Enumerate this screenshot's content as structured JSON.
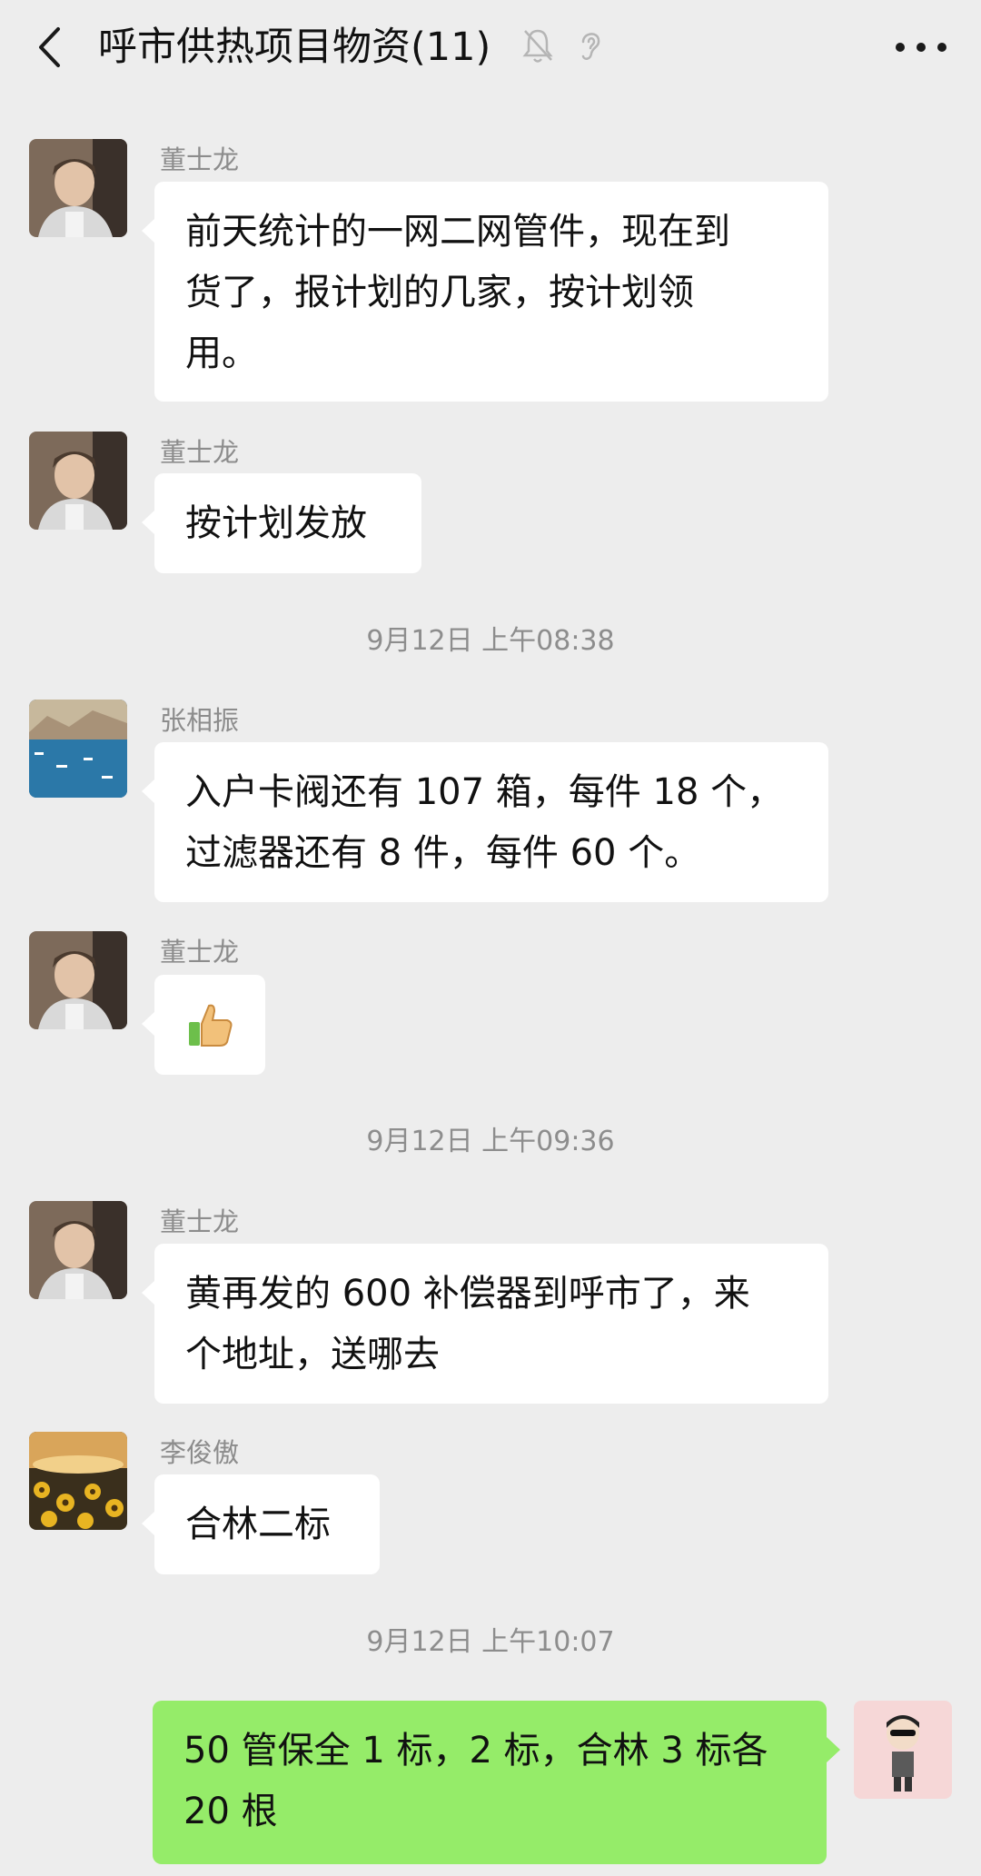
{
  "header": {
    "title": "呼市供热项目物资(11)",
    "icons": [
      "back-icon",
      "mute-bell-icon",
      "earpiece-icon",
      "more-icon"
    ]
  },
  "messages": [
    {
      "sender": "董士龙",
      "avatar": "girl-photo",
      "text_lines": [
        "前天统计的一网二网管件，现在到",
        "货了，报计划的几家，按计划领",
        "用。"
      ]
    },
    {
      "sender": "董士龙",
      "avatar": "girl-photo",
      "text_lines": [
        "按计划发放"
      ]
    },
    {
      "sender": "张相振",
      "avatar": "harbor-photo",
      "text_lines": [
        "入户卡阀还有 107 箱，每件 18 个，",
        "过滤器还有 8 件，每件 60 个。"
      ]
    },
    {
      "sender": "董士龙",
      "avatar": "girl-photo",
      "sticker": "thumbs-up-icon"
    },
    {
      "sender": "董士龙",
      "avatar": "girl-photo",
      "text_lines": [
        "黄再发的 600 补偿器到呼市了，来",
        "个地址，送哪去"
      ]
    },
    {
      "sender": "李俊傲",
      "avatar": "sunflower-photo",
      "text_lines": [
        "合林二标"
      ]
    },
    {
      "sender": "self",
      "avatar": "cartoon-avatar",
      "text_lines": [
        "50 管保全 1 标，2 标，合林 3 标各",
        "20 根"
      ]
    }
  ],
  "timestamps": [
    "9月12日 上午08:38",
    "9月12日 上午09:36",
    "9月12日 上午10:07"
  ],
  "colors": {
    "background": "#ededed",
    "bubble_incoming": "#ffffff",
    "bubble_outgoing": "#95ec69",
    "meta_text": "#8d8d8d"
  }
}
